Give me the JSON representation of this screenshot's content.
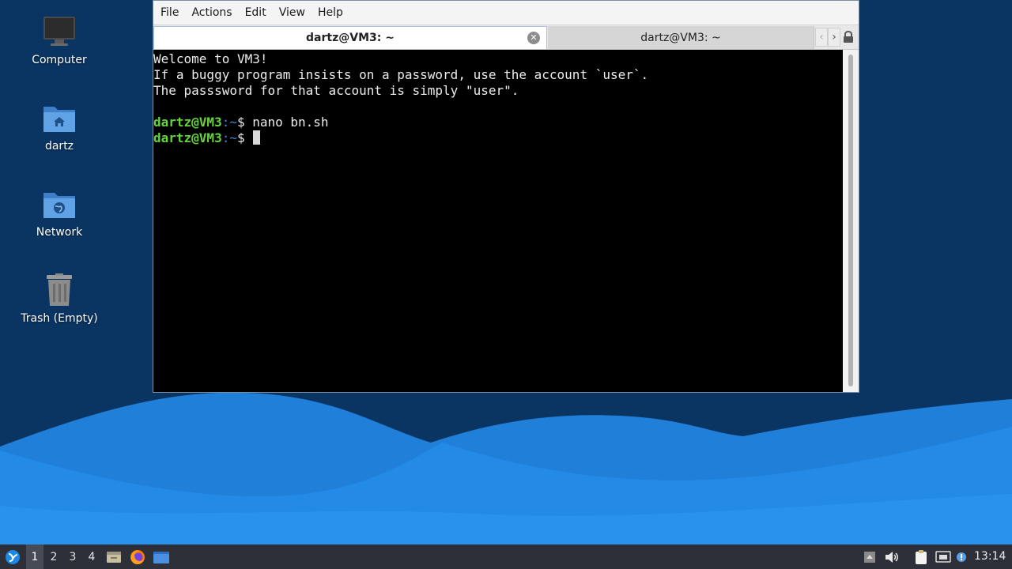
{
  "desktop": {
    "icons": [
      {
        "label": "Computer",
        "icon": "computer-icon"
      },
      {
        "label": "dartz",
        "icon": "home-folder-icon"
      },
      {
        "label": "Network",
        "icon": "network-folder-icon"
      },
      {
        "label": "Trash (Empty)",
        "icon": "trash-icon"
      }
    ]
  },
  "window": {
    "menu": [
      "File",
      "Actions",
      "Edit",
      "View",
      "Help"
    ],
    "tabs": [
      {
        "title": "dartz@VM3: ~",
        "active": true
      },
      {
        "title": "dartz@VM3: ~",
        "active": false
      }
    ],
    "terminal": {
      "lines": [
        "Welcome to VM3!",
        "If a buggy program insists on a password, use the account `user`.",
        "The passsword for that account is simply \"user\"."
      ],
      "prompt_user": "dartz@VM3",
      "prompt_path": ":~",
      "prompt_symbol": "$ ",
      "command": "nano bn.sh"
    }
  },
  "taskbar": {
    "workspaces": [
      "1",
      "2",
      "3",
      "4"
    ],
    "clock": "13:14"
  },
  "colors": {
    "prompt_user": "#63d43a",
    "prompt_path": "#4b7fd1",
    "taskbar": "#2d3038",
    "desktop": "#0a3563"
  }
}
